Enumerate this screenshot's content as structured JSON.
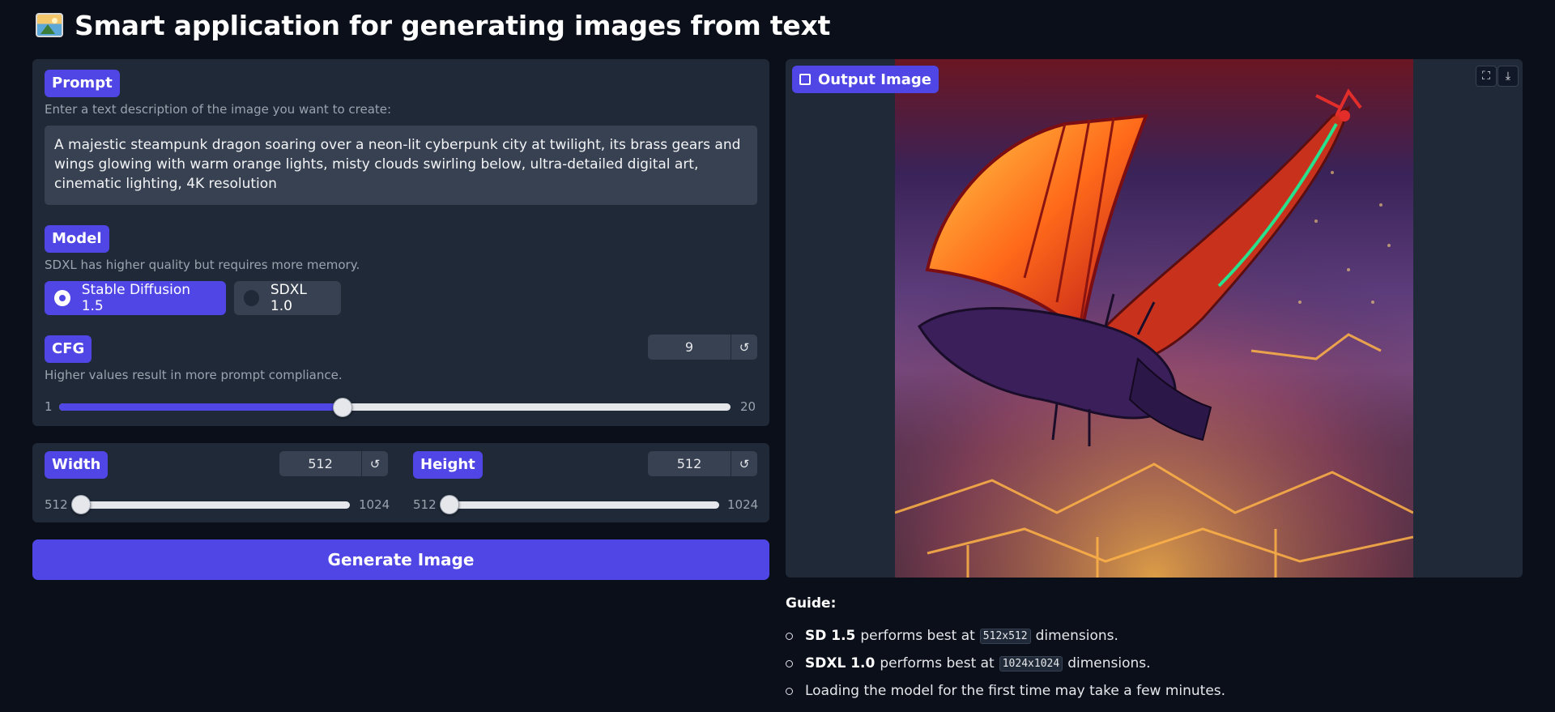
{
  "app": {
    "title": "Smart application for generating images from text",
    "title_icon": "framed-picture-emoji"
  },
  "prompt": {
    "label": "Prompt",
    "hint": "Enter a text description of the image you want to create:",
    "value": "A majestic steampunk dragon soaring over a neon-lit cyberpunk city at twilight, its brass gears and wings glowing with warm orange lights, misty clouds swirling below, ultra-detailed digital art, cinematic lighting, 4K resolution"
  },
  "model": {
    "label": "Model",
    "hint": "SDXL has higher quality but requires more memory.",
    "options": [
      "Stable Diffusion 1.5",
      "SDXL 1.0"
    ],
    "selected": "Stable Diffusion 1.5"
  },
  "cfg": {
    "label": "CFG",
    "hint": "Higher values result in more prompt compliance.",
    "value": "9",
    "min": "1",
    "max": "20",
    "reset_icon": "reset-icon"
  },
  "width": {
    "label": "Width",
    "value": "512",
    "min": "512",
    "max": "1024"
  },
  "height": {
    "label": "Height",
    "value": "512",
    "min": "512",
    "max": "1024"
  },
  "generate_button": "Generate Image",
  "output": {
    "label": "Output Image",
    "icons": [
      "fullscreen-icon",
      "download-icon"
    ]
  },
  "guide": {
    "title": "Guide:",
    "items": [
      {
        "bold": "SD 1.5",
        "pre": "performs best at",
        "code": "512x512",
        "post": "dimensions."
      },
      {
        "bold": "SDXL 1.0",
        "pre": "performs best at",
        "code": "1024x1024",
        "post": "dimensions."
      },
      {
        "text": "Loading the model for the first time may take a few minutes."
      }
    ]
  },
  "colors": {
    "background": "#0b0f19",
    "panel": "#1f2937",
    "accent": "#4f46e5",
    "input": "#374151"
  }
}
